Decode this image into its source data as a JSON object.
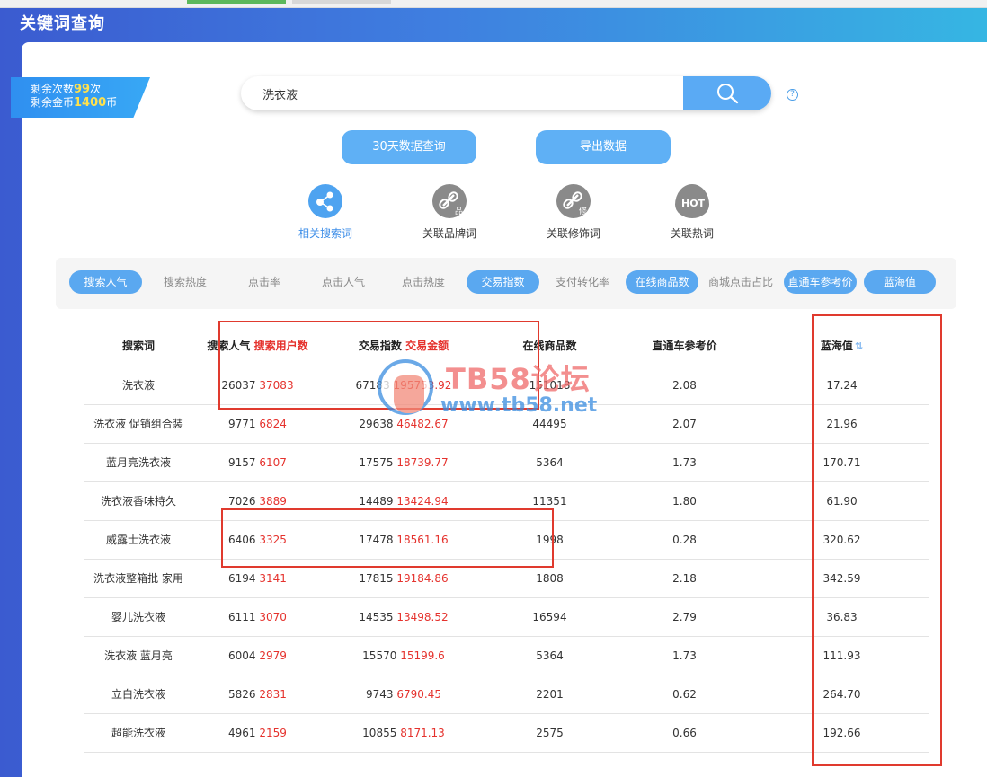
{
  "page": {
    "title": "关键词查询"
  },
  "quota": {
    "line1_prefix": "剩余次数",
    "line1_value": "99",
    "line1_suffix": "次",
    "line2_prefix": "剩余金币",
    "line2_value": "1400",
    "line2_suffix": "币"
  },
  "search": {
    "value": "洗衣液",
    "help": "?"
  },
  "actions": {
    "query_30days": "30天数据查询",
    "export": "导出数据"
  },
  "features": [
    {
      "label": "相关搜索词",
      "icon": "network-icon",
      "active": true
    },
    {
      "label": "关联品牌词",
      "icon": "link-brand-icon",
      "badge": "品"
    },
    {
      "label": "关联修饰词",
      "icon": "link-modifier-icon",
      "badge": "修"
    },
    {
      "label": "关联热词",
      "icon": "hot-icon",
      "badge": "HOT"
    }
  ],
  "filters": [
    {
      "label": "搜索人气",
      "on": true
    },
    {
      "label": "搜索热度",
      "on": false
    },
    {
      "label": "点击率",
      "on": false
    },
    {
      "label": "点击人气",
      "on": false
    },
    {
      "label": "点击热度",
      "on": false
    },
    {
      "label": "交易指数",
      "on": true
    },
    {
      "label": "支付转化率",
      "on": false
    },
    {
      "label": "在线商品数",
      "on": true
    },
    {
      "label": "商城点击占比",
      "on": false
    },
    {
      "label": "直通车参考价",
      "on": true
    },
    {
      "label": "蓝海值",
      "on": true
    }
  ],
  "table": {
    "headers": {
      "keyword": "搜索词",
      "popularity": "搜索人气",
      "users": "搜索用户数",
      "trade_index": "交易指数",
      "trade_amount": "交易金额",
      "online_items": "在线商品数",
      "ztc_price": "直通车参考价",
      "blue_ocean": "蓝海值"
    },
    "rows": [
      {
        "keyword": "洗衣液",
        "popularity": "26037",
        "users": "37083",
        "trade_index": "67183",
        "trade_amount": "195753.92",
        "online_items": "151018",
        "ztc_price": "2.08",
        "blue_ocean": "17.24"
      },
      {
        "keyword": "洗衣液 促销组合装",
        "popularity": "9771",
        "users": "6824",
        "trade_index": "29638",
        "trade_amount": "46482.67",
        "online_items": "44495",
        "ztc_price": "2.07",
        "blue_ocean": "21.96"
      },
      {
        "keyword": "蓝月亮洗衣液",
        "popularity": "9157",
        "users": "6107",
        "trade_index": "17575",
        "trade_amount": "18739.77",
        "online_items": "5364",
        "ztc_price": "1.73",
        "blue_ocean": "170.71"
      },
      {
        "keyword": "洗衣液香味持久",
        "popularity": "7026",
        "users": "3889",
        "trade_index": "14489",
        "trade_amount": "13424.94",
        "online_items": "11351",
        "ztc_price": "1.80",
        "blue_ocean": "61.90"
      },
      {
        "keyword": "威露士洗衣液",
        "popularity": "6406",
        "users": "3325",
        "trade_index": "17478",
        "trade_amount": "18561.16",
        "online_items": "1998",
        "ztc_price": "0.28",
        "blue_ocean": "320.62"
      },
      {
        "keyword": "洗衣液整箱批 家用",
        "popularity": "6194",
        "users": "3141",
        "trade_index": "17815",
        "trade_amount": "19184.86",
        "online_items": "1808",
        "ztc_price": "2.18",
        "blue_ocean": "342.59"
      },
      {
        "keyword": "婴儿洗衣液",
        "popularity": "6111",
        "users": "3070",
        "trade_index": "14535",
        "trade_amount": "13498.52",
        "online_items": "16594",
        "ztc_price": "2.79",
        "blue_ocean": "36.83"
      },
      {
        "keyword": "洗衣液 蓝月亮",
        "popularity": "6004",
        "users": "2979",
        "trade_index": "15570",
        "trade_amount": "15199.6",
        "online_items": "5364",
        "ztc_price": "1.73",
        "blue_ocean": "111.93"
      },
      {
        "keyword": "立白洗衣液",
        "popularity": "5826",
        "users": "2831",
        "trade_index": "9743",
        "trade_amount": "6790.45",
        "online_items": "2201",
        "ztc_price": "0.62",
        "blue_ocean": "264.70"
      },
      {
        "keyword": "超能洗衣液",
        "popularity": "4961",
        "users": "2159",
        "trade_index": "10855",
        "trade_amount": "8171.13",
        "online_items": "2575",
        "ztc_price": "0.66",
        "blue_ocean": "192.66"
      }
    ]
  },
  "watermark": {
    "line1": "TB58论坛",
    "line2": "www.tb58.net"
  },
  "colors": {
    "accent": "#5aa8f0",
    "highlight_red": "#e03a2e",
    "value_red": "#e5322d"
  }
}
